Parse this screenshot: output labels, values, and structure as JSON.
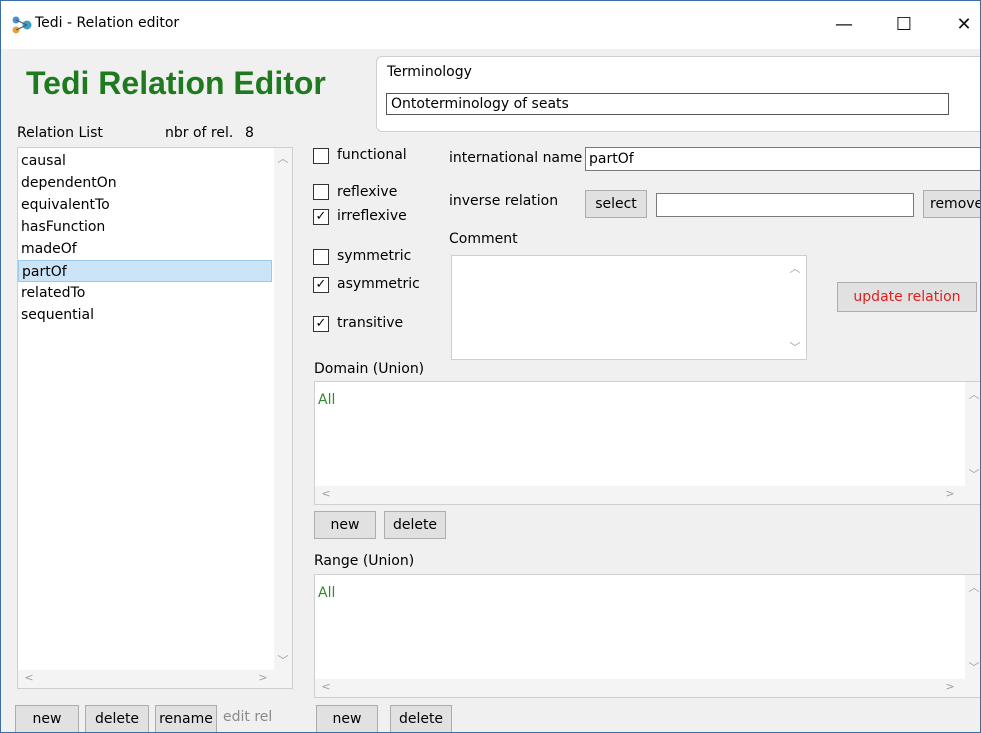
{
  "window": {
    "title": "Tedi - Relation editor",
    "minimize": "—",
    "maximize": "☐",
    "close": "✕"
  },
  "header": {
    "app_title": "Tedi Relation Editor"
  },
  "terminology": {
    "label": "Terminology",
    "value": "Ontoterminology of seats"
  },
  "relation_list": {
    "label": "Relation List",
    "count_label": "nbr of rel.",
    "count": "8",
    "items": [
      "causal",
      "dependentOn",
      "equivalentTo",
      "hasFunction",
      "madeOf",
      "partOf",
      "relatedTo",
      "sequential"
    ],
    "selected": "partOf",
    "buttons": {
      "new": "new",
      "delete": "delete",
      "rename": "rename",
      "edit": "edit rel"
    }
  },
  "properties": {
    "functional": {
      "label": "functional",
      "checked": false
    },
    "reflexive": {
      "label": "reflexive",
      "checked": false
    },
    "irreflexive": {
      "label": "irreflexive",
      "checked": true
    },
    "symmetric": {
      "label": "symmetric",
      "checked": false
    },
    "asymmetric": {
      "label": "asymmetric",
      "checked": true
    },
    "transitive": {
      "label": "transitive",
      "checked": true
    }
  },
  "relation": {
    "intl_name_label": "international name",
    "intl_name_value": "partOf",
    "inverse_label": "inverse relation",
    "select_button": "select",
    "inverse_value": "",
    "remove_button": "remove",
    "comment_label": "Comment",
    "comment_value": "",
    "update_button": "update relation",
    "update_color": "#e02020"
  },
  "domain": {
    "label": "Domain (Union)",
    "items": [
      "All"
    ],
    "new": "new",
    "delete": "delete"
  },
  "range": {
    "label": "Range (Union)",
    "items": [
      "All"
    ],
    "new": "new",
    "delete": "delete"
  },
  "colors": {
    "title_green": "#1f7a1f",
    "item_green": "#2e8b2e",
    "selection": "#cce4f7"
  }
}
